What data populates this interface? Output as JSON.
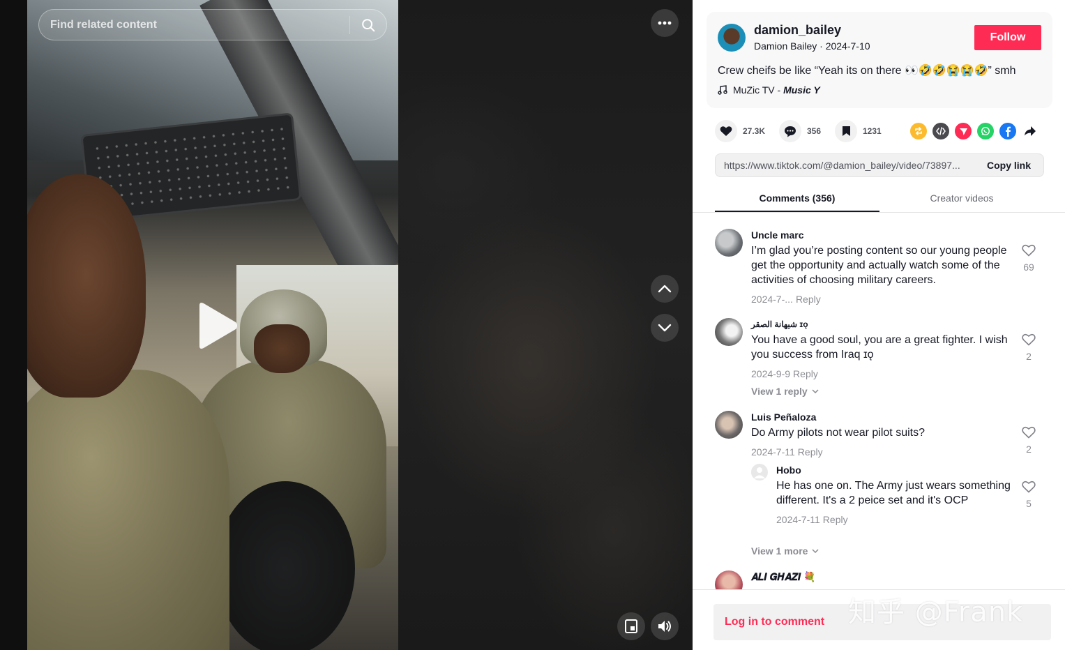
{
  "search": {
    "placeholder": "Find related content"
  },
  "author": {
    "username": "damion_bailey",
    "display_name": "Damion Bailey",
    "date": "2024-7-10",
    "subtitle": "Damion Bailey · 2024-7-10"
  },
  "follow_label": "Follow",
  "caption": "Crew cheifs be like “Yeah its on there 👀🤣🤣😭😭🤣” smh",
  "music": {
    "icon": "music-note-icon",
    "artist": "MuZic TV - ",
    "title": "Music Y"
  },
  "stats": {
    "likes": "27.3K",
    "comments": "356",
    "saves": "1231"
  },
  "share_icons": [
    "repost-icon",
    "embed-icon",
    "send-icon",
    "whatsapp-icon",
    "facebook-icon",
    "share-arrow-icon"
  ],
  "link": {
    "url": "https://www.tiktok.com/@damion_bailey/video/73897...",
    "copy_label": "Copy link"
  },
  "tabs": [
    {
      "label": "Comments (356)"
    },
    {
      "label": "Creator videos"
    }
  ],
  "comments": [
    {
      "user": "Uncle marc",
      "text": "I’m glad you’re posting content so our young people get the opportunity and actually watch some of the activities of choosing military careers.",
      "date": "2024-7-...",
      "reply": "Reply",
      "likes": "69"
    },
    {
      "user": "شيهانة الصقر ɪǫ",
      "text": "You have a good soul, you are a great fighter. I wish you success from Iraq ɪǫ",
      "date": "2024-9-9",
      "reply": "Reply",
      "likes": "2",
      "view_more": "View 1 reply"
    },
    {
      "user": "Luis Peñaloza",
      "text": "Do Army pilots not wear pilot suits?",
      "date": "2024-7-11",
      "reply": "Reply",
      "likes": "2",
      "view_more": "View 1 more",
      "replies": [
        {
          "user": "Hobo",
          "text": "He has one on. The Army just wears something different. It's a 2 peice set and it's OCP",
          "date": "2024-7-11",
          "reply": "Reply",
          "likes": "5"
        }
      ]
    },
    {
      "user": "𝑨𝑳𝑰 𝑮𝑯𝑨𝒁𝑰 💐"
    }
  ],
  "login_comment": "Log in to comment",
  "watermark": "知乎 @Frank",
  "colors": {
    "brand": "#fe2c55",
    "text": "#161823",
    "muted": "rgba(22,24,35,0.5)"
  }
}
